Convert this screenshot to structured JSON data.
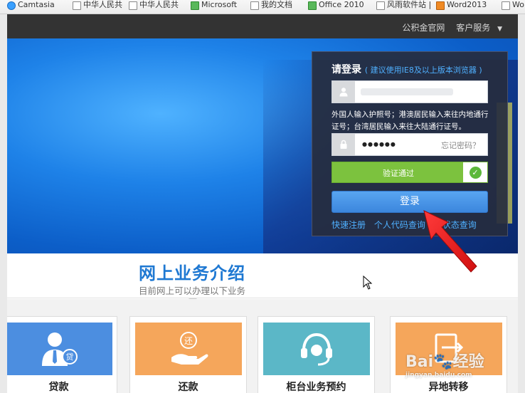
{
  "bookmarks": [
    {
      "label": "Camtasia",
      "icon": "camtasia-icon"
    },
    {
      "label": "中华人民共",
      "icon": "page-icon"
    },
    {
      "label": "中华人民共",
      "icon": "page-icon"
    },
    {
      "label": "Microsoft",
      "icon": "microsoft-icon"
    },
    {
      "label": "我的文档",
      "icon": "page-icon"
    },
    {
      "label": "Office 2010",
      "icon": "office-icon"
    },
    {
      "label": "风雨软件站 |",
      "icon": "page-icon"
    },
    {
      "label": "Word2013",
      "icon": "word-icon"
    },
    {
      "label": "Wo",
      "icon": "page-icon"
    }
  ],
  "topbar": {
    "official_site": "公积金官网",
    "customer_service": "客户服务",
    "caret": "▼"
  },
  "login": {
    "title": "请登录",
    "hint": "( 建议使用IE8及以上版本浏览器 )",
    "id_note": "外国人输入护照号；港澳居民输入来往内地通行证号；台湾居民输入来往大陆通行证号。",
    "password_mask": "●●●●●●",
    "forgot_password": "忘记密码？",
    "verify_label": "验证通过",
    "verify_check": "✓",
    "login_button": "登录",
    "links": [
      "快速注册",
      "个人代码查询",
      "户状态查询"
    ]
  },
  "intro": {
    "title": "网上业务介绍",
    "subtitle": "目前网上可以办理以下业务"
  },
  "services": [
    {
      "name": "贷款",
      "color": "#4c8ee0",
      "icon": "loan-person-icon",
      "badge": "贷"
    },
    {
      "name": "还款",
      "color": "#f5a65b",
      "icon": "repay-hand-icon",
      "badge": "还"
    },
    {
      "name": "柜台业务预约",
      "color": "#5bb7c7",
      "icon": "headset-icon",
      "badge": ""
    },
    {
      "name": "异地转移",
      "color": "#f5a65b",
      "icon": "transfer-icon",
      "badge": ""
    }
  ],
  "watermark": {
    "text": "Bai",
    "text2": "经验",
    "sub": "jingyan.baidu.com"
  }
}
